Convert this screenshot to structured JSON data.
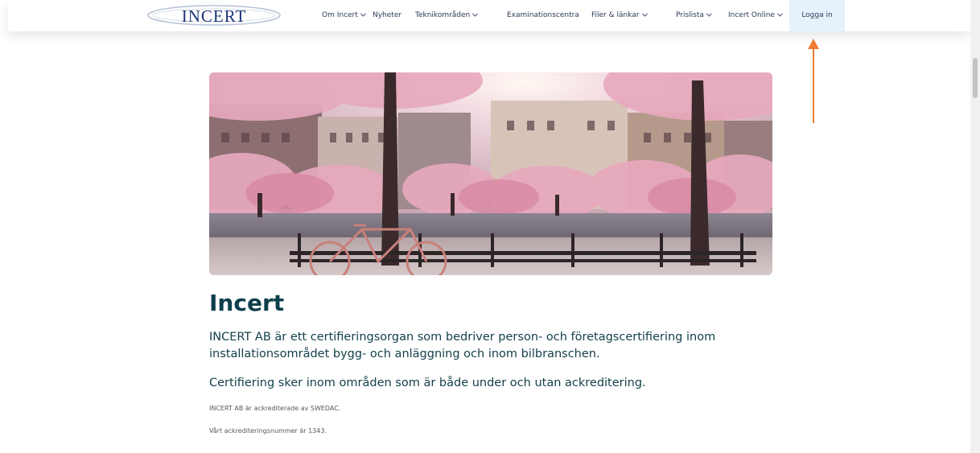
{
  "nav": {
    "logo_text": "INCERT",
    "items": [
      {
        "label": "Om Incert",
        "has_dropdown": true
      },
      {
        "label": "Nyheter",
        "has_dropdown": false
      },
      {
        "label": "Teknikområden",
        "has_dropdown": true
      },
      {
        "label": "Examinationscentra",
        "has_dropdown": false
      },
      {
        "label": "Filer & länkar",
        "has_dropdown": true
      },
      {
        "label": "Prislista",
        "has_dropdown": true
      },
      {
        "label": "Incert Online",
        "has_dropdown": true
      }
    ],
    "login_label": "Logga in"
  },
  "hero": {
    "icon": "cherry-blossom-park-image"
  },
  "content": {
    "title": "Incert",
    "intro_line1": "INCERT AB är ett certifieringsorgan som bedriver person- och företagscertifiering inom",
    "intro_line2": "installationsområdet bygg- och anläggning och inom bilbranschen.",
    "intro2": "Certifiering sker inom områden som är både under och utan ackreditering.",
    "accreditation": "INCERT AB är ackrediterade av SWEDAC.",
    "accreditation_number": "Vårt ackrediteringsnummer är 1343."
  },
  "colors": {
    "title": "#0e3f4c",
    "body_text": "#14404a",
    "login_bg": "#e5f1fb",
    "arrow": "#ee7d33",
    "logo": "#1c3478"
  }
}
